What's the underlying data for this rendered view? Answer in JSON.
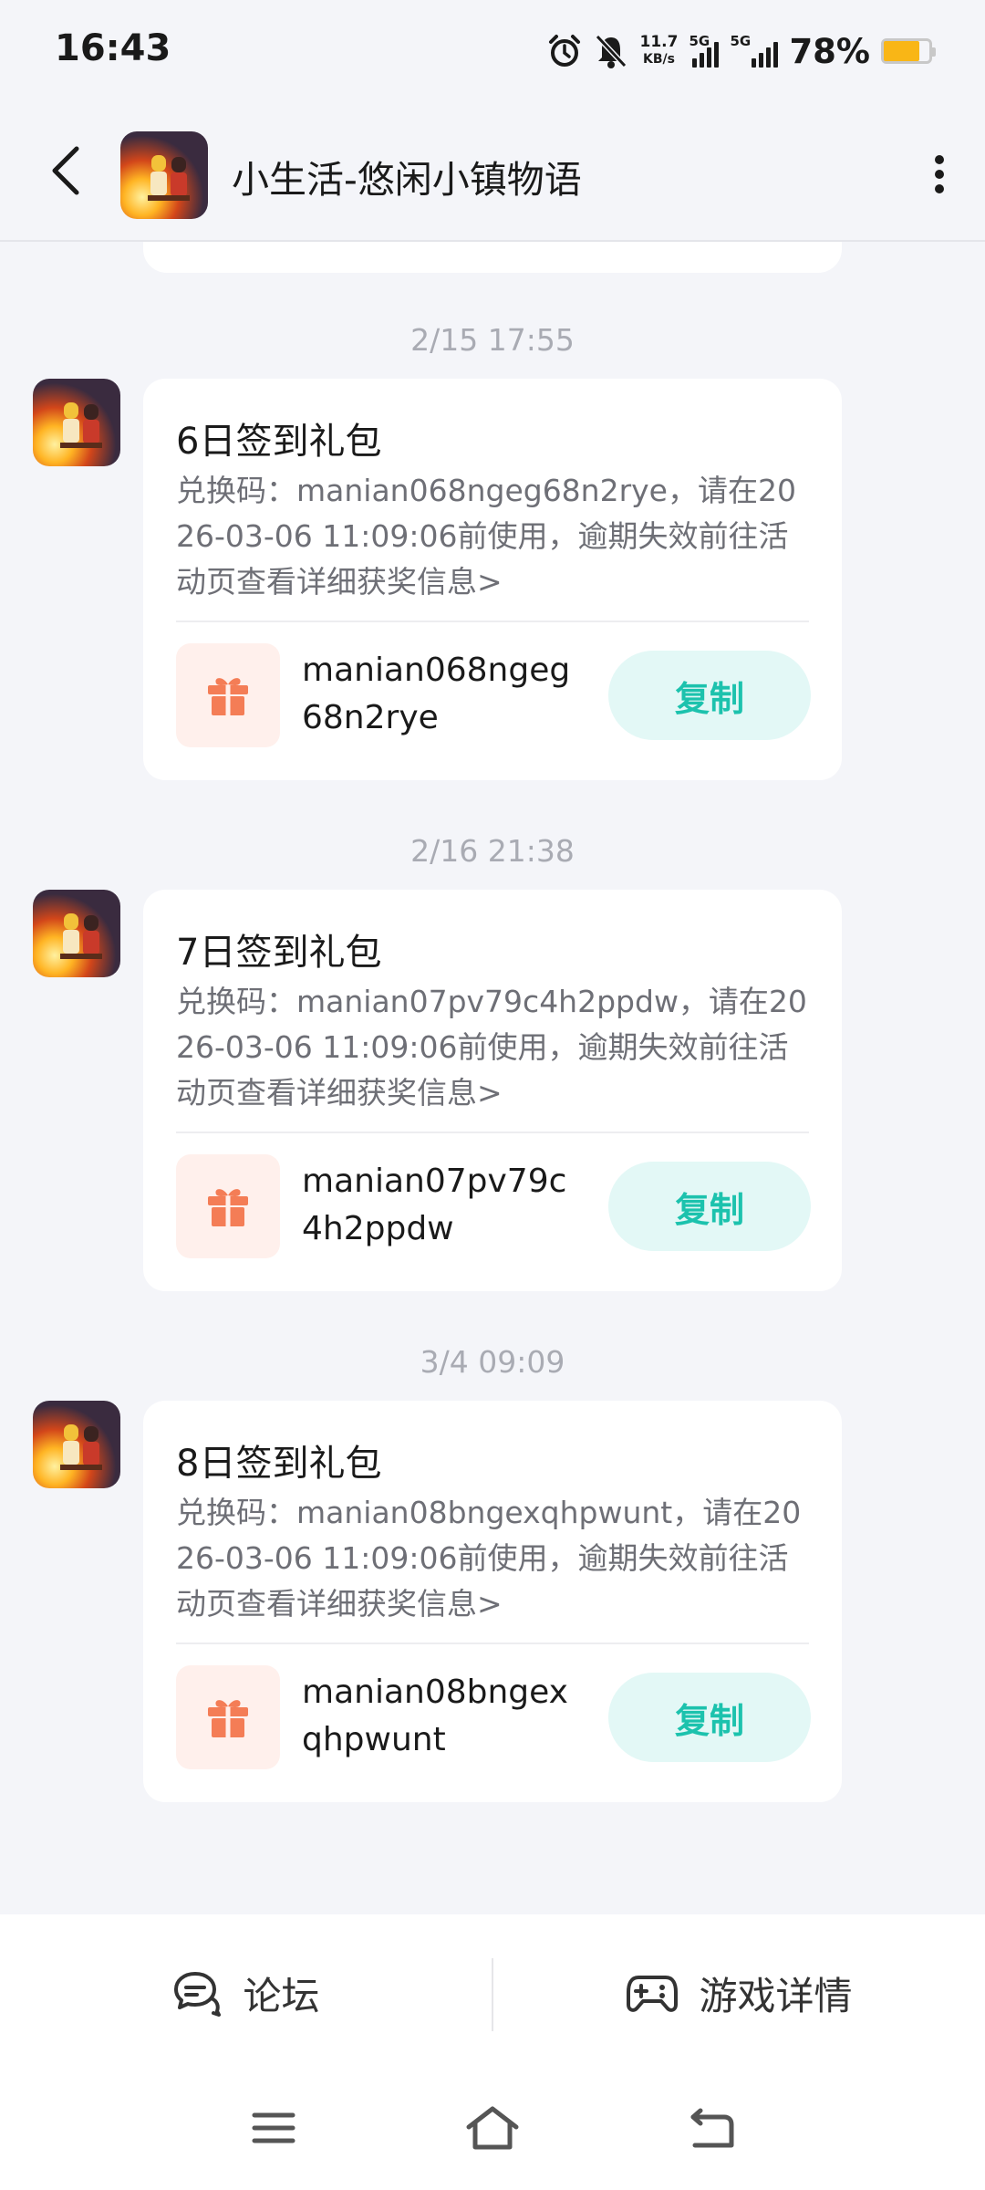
{
  "status_bar": {
    "time": "16:43",
    "net_speed_value": "11.7",
    "net_speed_unit": "KB/s",
    "sim1_label": "5G",
    "sim2_label": "5G",
    "battery_percent": "78%",
    "battery_level": 0.78,
    "battery_color": "#f9b616"
  },
  "header": {
    "title": "小生活-悠闲小镇物语"
  },
  "messages": [
    {
      "time": "2/15  17:55",
      "title": "6日签到礼包",
      "description": "兑换码：manian068ngeg68n2rye，请在2026-03-06 11:09:06前使用，逾期失效前往活动页查看详细获奖信息>",
      "code": "manian068ngeg68n2rye",
      "copy_label": "复制"
    },
    {
      "time": "2/16  21:38",
      "title": "7日签到礼包",
      "description": "兑换码：manian07pv79c4h2ppdw，请在2026-03-06 11:09:06前使用，逾期失效前往活动页查看详细获奖信息>",
      "code": "manian07pv79c4h2ppdw",
      "copy_label": "复制"
    },
    {
      "time": "3/4  09:09",
      "title": "8日签到礼包",
      "description": "兑换码：manian08bngexqhpwunt，请在2026-03-06 11:09:06前使用，逾期失效前往活动页查看详细获奖信息>",
      "code": "manian08bngexqhpwunt",
      "copy_label": "复制"
    }
  ],
  "bottom_tabs": {
    "forum_label": "论坛",
    "game_details_label": "游戏详情"
  },
  "colors": {
    "accent_teal": "#1cc2ad",
    "gift_orange": "#f47d56",
    "background": "#f4f5f9"
  }
}
